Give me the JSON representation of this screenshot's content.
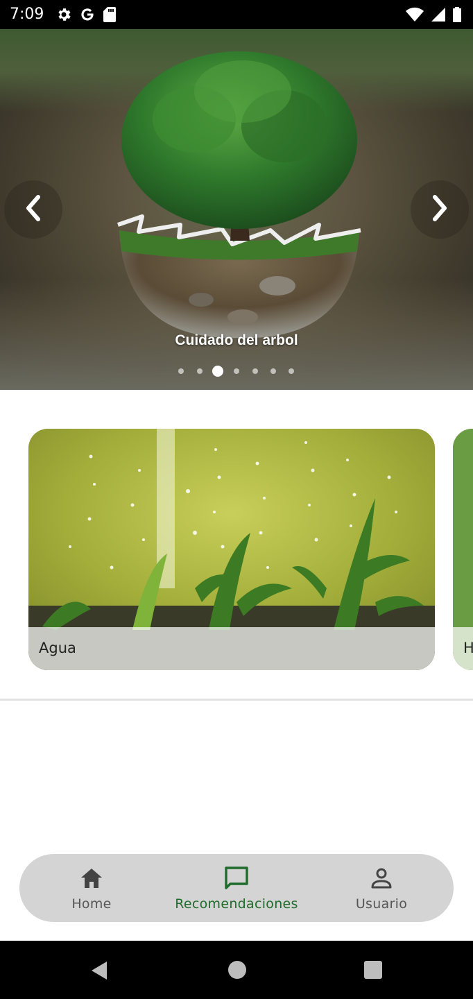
{
  "status_bar": {
    "time": "7:09",
    "left_icons": [
      "settings-icon",
      "google-icon",
      "sd-card-icon"
    ],
    "right_icons": [
      "wifi-icon",
      "signal-icon",
      "battery-icon"
    ]
  },
  "carousel": {
    "caption": "Cuidado del arbol",
    "prev_icon": "chevron-left-icon",
    "next_icon": "chevron-right-icon",
    "total_slides": 7,
    "active_index": 2
  },
  "cards": [
    {
      "label": "Agua"
    },
    {
      "label": "H"
    }
  ],
  "bottom_nav": {
    "items": [
      {
        "label": "Home",
        "icon": "home-icon"
      },
      {
        "label": "Recomendaciones",
        "icon": "message-square-icon",
        "selected": true
      },
      {
        "label": "Usuario",
        "icon": "user-icon"
      }
    ],
    "selected_color": "#1e6b2b"
  },
  "system_nav": {
    "buttons": [
      "back-icon",
      "home-circle-icon",
      "recents-icon"
    ]
  }
}
